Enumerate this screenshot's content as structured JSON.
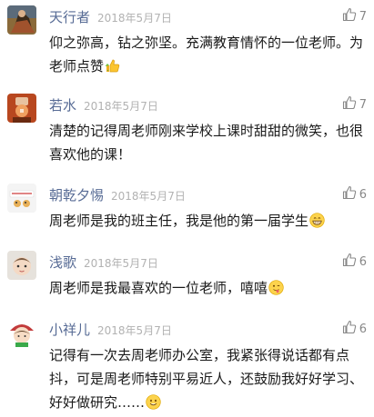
{
  "comments": [
    {
      "author": "天行者",
      "date": "2018年5月7日",
      "likes": "7",
      "text": "仰之弥高，钻之弥坚。充满教育情怀的一位老师。为老师点赞",
      "emoji": "thumbs-up-emoji"
    },
    {
      "author": "若水",
      "date": "2018年5月7日",
      "likes": "7",
      "text": "清楚的记得周老师刚来学校上课时甜甜的微笑，也很喜欢他的课！",
      "emoji": ""
    },
    {
      "author": "朝乾夕惕",
      "date": "2018年5月7日",
      "likes": "6",
      "text": "周老师是我的班主任，我是他的第一届学生",
      "emoji": "grinning-emoji"
    },
    {
      "author": "浅歌",
      "date": "2018年5月7日",
      "likes": "6",
      "text": "周老师是我最喜欢的一位老师，嘻嘻",
      "emoji": "winking-tongue-emoji"
    },
    {
      "author": "小祥儿",
      "date": "2018年5月7日",
      "likes": "6",
      "text": "记得有一次去周老师办公室，我紧张得说话都有点抖，可是周老师特别平易近人，还鼓励我好好学习、好好做研究……",
      "emoji": "smiling-emoji"
    }
  ],
  "colors": {
    "author": "#576b95",
    "date": "#b2b2b2",
    "text": "#1a1a1a",
    "like_icon": "#888888"
  }
}
